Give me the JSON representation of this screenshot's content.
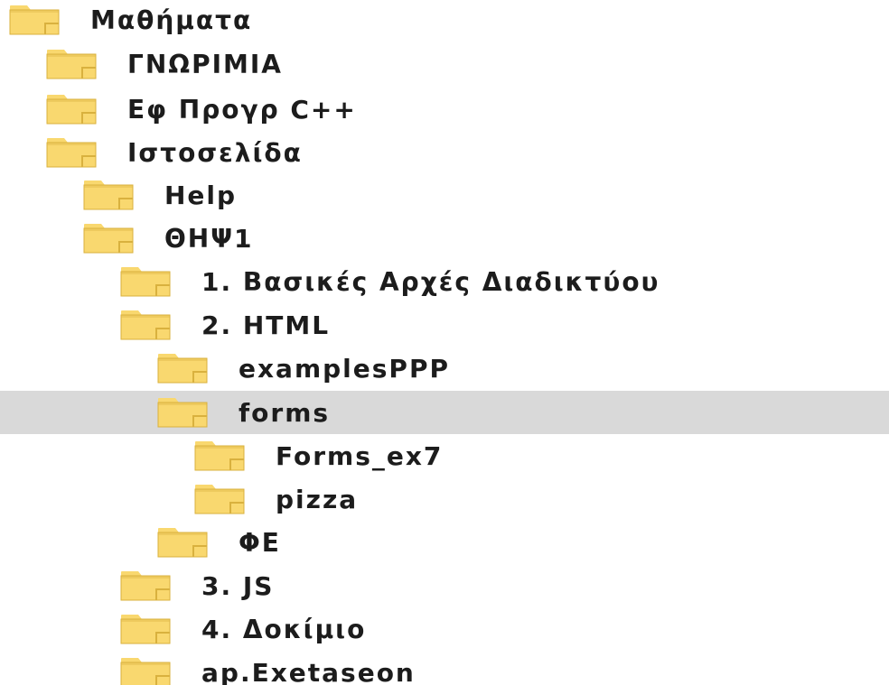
{
  "tree": {
    "items": [
      {
        "label": "Μαθήματα",
        "depth": 0,
        "selected": false
      },
      {
        "label": "ΓΝΩΡΙΜΙΑ",
        "depth": 1,
        "selected": false
      },
      {
        "label": "Εφ Προγρ C++",
        "depth": 1,
        "selected": false
      },
      {
        "label": "Ιστοσελίδα",
        "depth": 1,
        "selected": false
      },
      {
        "label": "Help",
        "depth": 2,
        "selected": false
      },
      {
        "label": "ΘΗΨ1",
        "depth": 2,
        "selected": false
      },
      {
        "label": "1. Βασικές Αρχές Διαδικτύου",
        "depth": 3,
        "selected": false
      },
      {
        "label": "2. HTML",
        "depth": 3,
        "selected": false
      },
      {
        "label": "examplesPPP",
        "depth": 4,
        "selected": false
      },
      {
        "label": "forms",
        "depth": 4,
        "selected": true
      },
      {
        "label": "Forms_ex7",
        "depth": 5,
        "selected": false
      },
      {
        "label": "pizza",
        "depth": 5,
        "selected": false
      },
      {
        "label": "ΦΕ",
        "depth": 4,
        "selected": false
      },
      {
        "label": "3. JS",
        "depth": 3,
        "selected": false
      },
      {
        "label": "4. Δοκίμιο",
        "depth": 3,
        "selected": false
      },
      {
        "label": "ap.Exetaseon",
        "depth": 3,
        "selected": false
      }
    ],
    "icon": "folder-icon",
    "colors": {
      "folder_fill": "#f9d86f",
      "folder_edge": "#d9b13e",
      "selected_bg": "#d9d9d9",
      "text": "#1c1c1c"
    }
  }
}
